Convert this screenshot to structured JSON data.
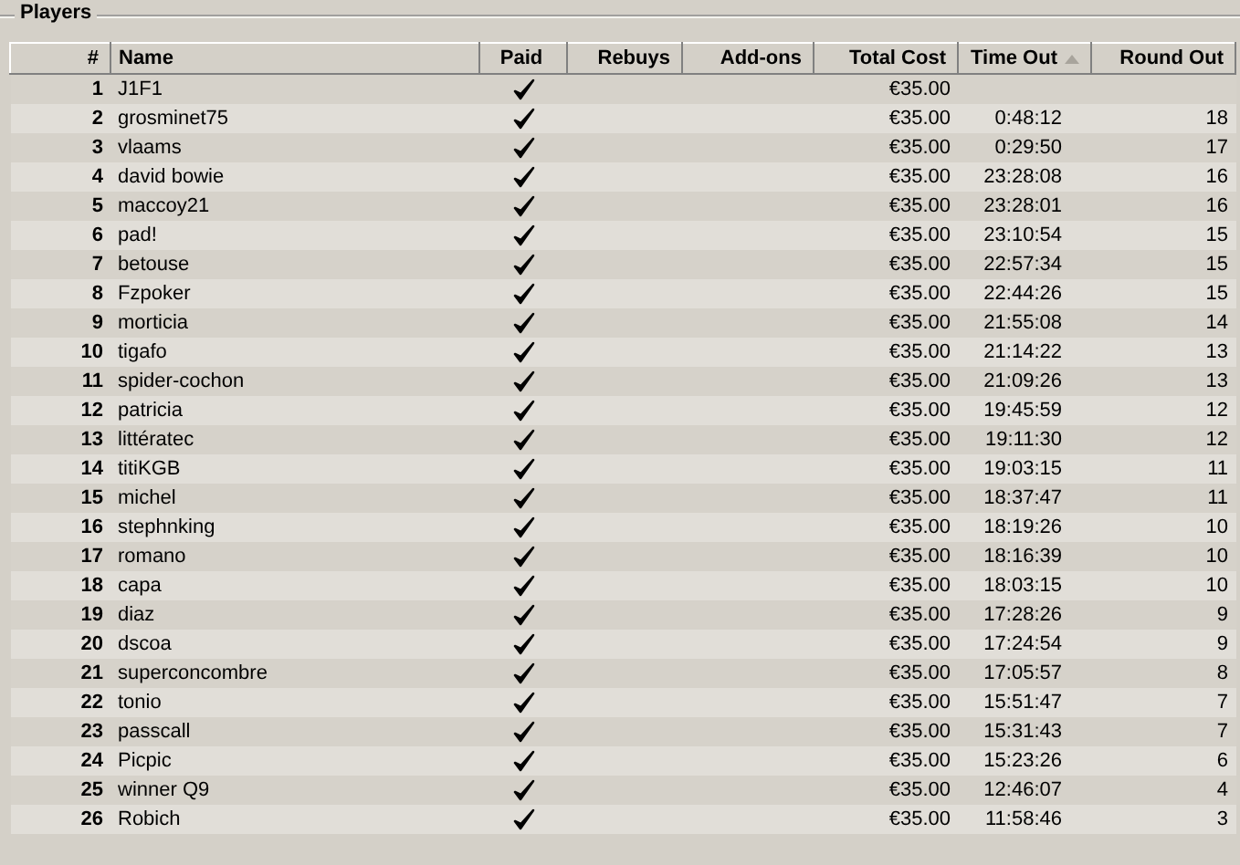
{
  "group_title": "Players",
  "columns": [
    {
      "label": "#",
      "sorted": false
    },
    {
      "label": "Name",
      "sorted": false
    },
    {
      "label": "Paid",
      "sorted": false
    },
    {
      "label": "Rebuys",
      "sorted": false
    },
    {
      "label": "Add-ons",
      "sorted": false
    },
    {
      "label": "Total Cost",
      "sorted": false
    },
    {
      "label": "Time Out",
      "sorted": true
    },
    {
      "label": "Round Out",
      "sorted": false
    }
  ],
  "rows": [
    {
      "rank": "1",
      "name": "J1F1",
      "paid": true,
      "total_cost": "€35.00"
    },
    {
      "rank": "2",
      "name": "grosminet75",
      "paid": true,
      "total_cost": "€35.00",
      "time_out": "0:48:12",
      "round_out": "18"
    },
    {
      "rank": "3",
      "name": "vlaams",
      "paid": true,
      "total_cost": "€35.00",
      "time_out": "0:29:50",
      "round_out": "17"
    },
    {
      "rank": "4",
      "name": "david bowie",
      "paid": true,
      "total_cost": "€35.00",
      "time_out": "23:28:08",
      "round_out": "16"
    },
    {
      "rank": "5",
      "name": "maccoy21",
      "paid": true,
      "total_cost": "€35.00",
      "time_out": "23:28:01",
      "round_out": "16"
    },
    {
      "rank": "6",
      "name": "pad!",
      "paid": true,
      "total_cost": "€35.00",
      "time_out": "23:10:54",
      "round_out": "15"
    },
    {
      "rank": "7",
      "name": "betouse",
      "paid": true,
      "total_cost": "€35.00",
      "time_out": "22:57:34",
      "round_out": "15"
    },
    {
      "rank": "8",
      "name": "Fzpoker",
      "paid": true,
      "total_cost": "€35.00",
      "time_out": "22:44:26",
      "round_out": "15"
    },
    {
      "rank": "9",
      "name": "morticia",
      "paid": true,
      "total_cost": "€35.00",
      "time_out": "21:55:08",
      "round_out": "14"
    },
    {
      "rank": "10",
      "name": "tigafo",
      "paid": true,
      "total_cost": "€35.00",
      "time_out": "21:14:22",
      "round_out": "13"
    },
    {
      "rank": "11",
      "name": "spider-cochon",
      "paid": true,
      "total_cost": "€35.00",
      "time_out": "21:09:26",
      "round_out": "13"
    },
    {
      "rank": "12",
      "name": "patricia",
      "paid": true,
      "total_cost": "€35.00",
      "time_out": "19:45:59",
      "round_out": "12"
    },
    {
      "rank": "13",
      "name": "littératec",
      "paid": true,
      "total_cost": "€35.00",
      "time_out": "19:11:30",
      "round_out": "12"
    },
    {
      "rank": "14",
      "name": "titiKGB",
      "paid": true,
      "total_cost": "€35.00",
      "time_out": "19:03:15",
      "round_out": "11"
    },
    {
      "rank": "15",
      "name": "michel",
      "paid": true,
      "total_cost": "€35.00",
      "time_out": "18:37:47",
      "round_out": "11"
    },
    {
      "rank": "16",
      "name": "stephnking",
      "paid": true,
      "total_cost": "€35.00",
      "time_out": "18:19:26",
      "round_out": "10"
    },
    {
      "rank": "17",
      "name": "romano",
      "paid": true,
      "total_cost": "€35.00",
      "time_out": "18:16:39",
      "round_out": "10"
    },
    {
      "rank": "18",
      "name": "capa",
      "paid": true,
      "total_cost": "€35.00",
      "time_out": "18:03:15",
      "round_out": "10"
    },
    {
      "rank": "19",
      "name": "diaz",
      "paid": true,
      "total_cost": "€35.00",
      "time_out": "17:28:26",
      "round_out": "9"
    },
    {
      "rank": "20",
      "name": "dscoa",
      "paid": true,
      "total_cost": "€35.00",
      "time_out": "17:24:54",
      "round_out": "9"
    },
    {
      "rank": "21",
      "name": "superconcombre",
      "paid": true,
      "total_cost": "€35.00",
      "time_out": "17:05:57",
      "round_out": "8"
    },
    {
      "rank": "22",
      "name": "tonio",
      "paid": true,
      "total_cost": "€35.00",
      "time_out": "15:51:47",
      "round_out": "7"
    },
    {
      "rank": "23",
      "name": "passcall",
      "paid": true,
      "total_cost": "€35.00",
      "time_out": "15:31:43",
      "round_out": "7"
    },
    {
      "rank": "24",
      "name": "Picpic",
      "paid": true,
      "total_cost": "€35.00",
      "time_out": "15:23:26",
      "round_out": "6"
    },
    {
      "rank": "25",
      "name": "winner Q9",
      "paid": true,
      "total_cost": "€35.00",
      "time_out": "12:46:07",
      "round_out": "4"
    },
    {
      "rank": "26",
      "name": "Robich",
      "paid": true,
      "total_cost": "€35.00",
      "time_out": "11:58:46",
      "round_out": "3"
    }
  ]
}
